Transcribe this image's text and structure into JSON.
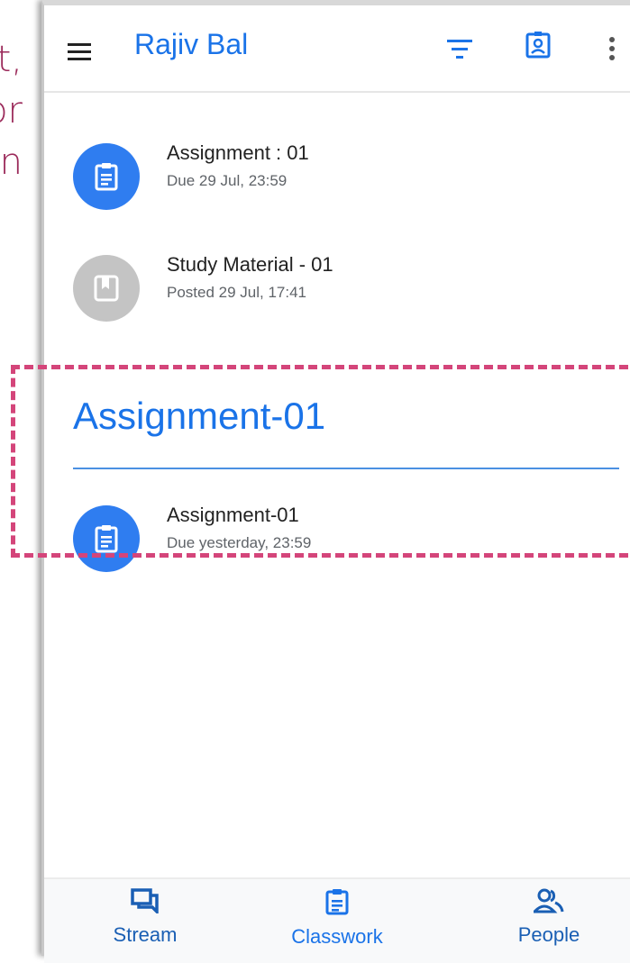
{
  "background_text": [
    "t,",
    "or",
    "n"
  ],
  "header": {
    "title": "Rajiv Bal",
    "icons": [
      "menu-icon",
      "filter-icon",
      "class-badge-icon",
      "more-vert-icon"
    ]
  },
  "items": [
    {
      "title": "Assignment : 01",
      "subtitle": "Due 29 Jul, 23:59",
      "icon": "assignment-icon",
      "color": "#2f7df0"
    },
    {
      "title": "Study Material - 01",
      "subtitle": "Posted 29 Jul, 17:41",
      "icon": "material-icon",
      "color": "#c4c4c4"
    }
  ],
  "topic": {
    "title": "Assignment-01",
    "items": [
      {
        "title": "Assignment-01",
        "subtitle": "Due yesterday, 23:59",
        "icon": "assignment-icon",
        "color": "#2f7df0"
      }
    ]
  },
  "bottom_nav": [
    {
      "label": "Stream",
      "icon": "stream-icon"
    },
    {
      "label": "Classwork",
      "icon": "classwork-icon",
      "active": true
    },
    {
      "label": "People",
      "icon": "people-icon"
    }
  ],
  "colors": {
    "accent": "#1a73e8",
    "highlight": "#d4457a",
    "slide_text": "#9b2a5a"
  }
}
